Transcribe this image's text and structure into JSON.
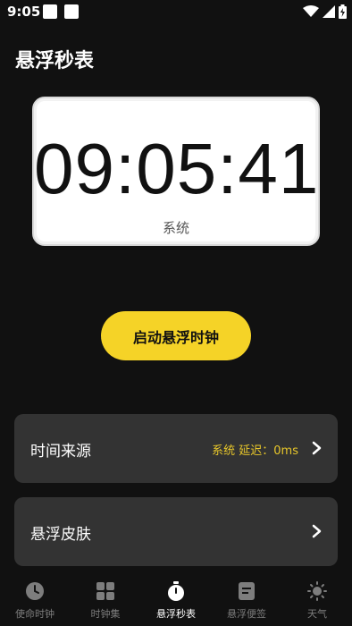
{
  "status_bar": {
    "time": "9:05"
  },
  "header": {
    "title": "悬浮秒表"
  },
  "clock": {
    "time": "09:05:41",
    "source": "系统"
  },
  "actions": {
    "start_label": "启动悬浮时钟"
  },
  "settings": [
    {
      "label": "时间来源",
      "value": "系统 延迟：0ms"
    },
    {
      "label": "悬浮皮肤",
      "value": ""
    }
  ],
  "tabs": [
    {
      "label": "使命时钟",
      "icon": "clock-icon",
      "active": false
    },
    {
      "label": "时钟集",
      "icon": "grid-icon",
      "active": false
    },
    {
      "label": "悬浮秒表",
      "icon": "stopwatch-icon",
      "active": true
    },
    {
      "label": "悬浮便签",
      "icon": "note-icon",
      "active": false
    },
    {
      "label": "天气",
      "icon": "sun-icon",
      "active": false
    }
  ],
  "colors": {
    "accent": "#f5d327",
    "value_text": "#e8c72a",
    "background": "#111111",
    "card": "#333333"
  }
}
